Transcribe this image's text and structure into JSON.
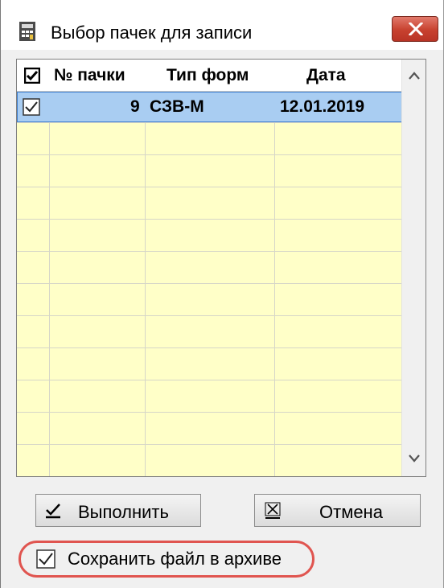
{
  "window": {
    "title": "Выбор пачек для записи",
    "close_glyph": "✕",
    "app_icon": "app-calculator-icon"
  },
  "table": {
    "columns": {
      "check_all": "select-all-checkbox",
      "number": "№ пачки",
      "form_type": "Тип форм",
      "date": "Дата"
    },
    "rows": [
      {
        "checked": true,
        "number": "9",
        "form_type": "СЗВ-М",
        "date": "12.01.2019",
        "selected": true
      }
    ]
  },
  "buttons": {
    "execute": "Выполнить",
    "cancel": "Отмена"
  },
  "archive": {
    "label": "Сохранить файл в архиве",
    "checked": true
  },
  "colors": {
    "grid_background": "#ffffc8",
    "selection": "#a9cdf2",
    "selection_border": "#3f7fd0",
    "close_button": "#c7412f",
    "highlight": "#e05550"
  }
}
